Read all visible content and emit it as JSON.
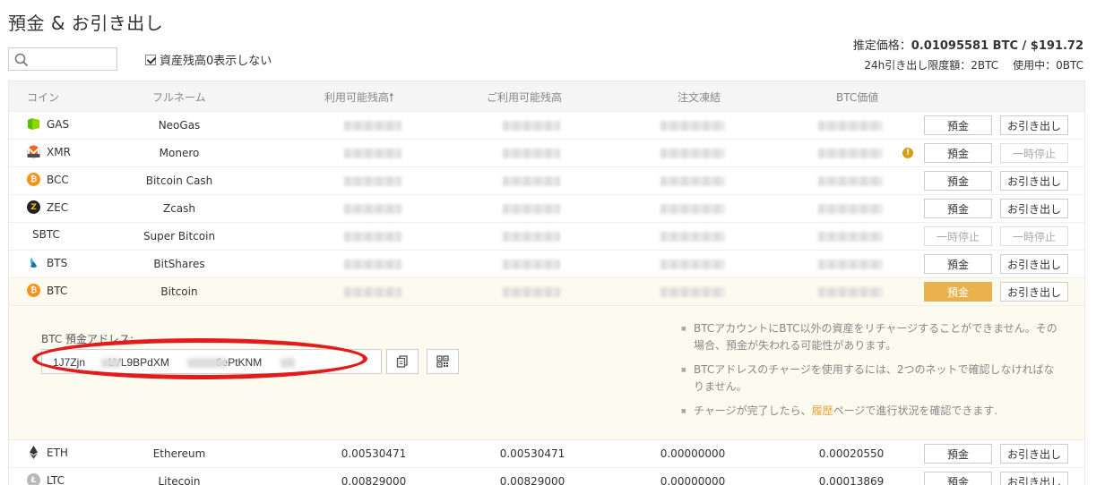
{
  "page": {
    "title": "預金 & お引き出し",
    "search_placeholder": "",
    "hide_zero_label": "資産残高0表示しない",
    "estimate_label": "推定価格：",
    "estimate_value": "0.01095581 BTC / $191.72",
    "limit_label": "24h引き出し限度額：2BTC",
    "in_use_label": "使用中：0BTC"
  },
  "table": {
    "headers": {
      "coin": "コイン",
      "fullname": "フルネーム",
      "available": "利用可能残高",
      "your_available": "ご利用可能残高",
      "frozen": "注文凍結",
      "btc_value": "BTC価値"
    },
    "deposit_label": "預金",
    "withdraw_label": "お引き出し",
    "suspended_label": "一時停止",
    "rows": [
      {
        "coin": "GAS",
        "name": "NeoGas",
        "icon": "neogas-icon",
        "color": "#58bf00"
      },
      {
        "coin": "XMR",
        "name": "Monero",
        "icon": "monero-icon",
        "color": "#f26822"
      },
      {
        "coin": "BCC",
        "name": "Bitcoin Cash",
        "icon": "bitcoin-cash-icon",
        "color": "#f7931a"
      },
      {
        "coin": "ZEC",
        "name": "Zcash",
        "icon": "zcash-icon",
        "color": "#222222"
      },
      {
        "coin": "SBTC",
        "name": "Super Bitcoin",
        "icon": "",
        "color": ""
      },
      {
        "coin": "BTS",
        "name": "BitShares",
        "icon": "bitshares-icon",
        "color": "#35baeb"
      },
      {
        "coin": "BTC",
        "name": "Bitcoin",
        "icon": "bitcoin-icon",
        "color": "#f7931a"
      }
    ],
    "eth_row": {
      "coin": "ETH",
      "name": "Ethereum",
      "available": "0.00530471",
      "your_available": "0.00530471",
      "frozen": "0.00000000",
      "btc_value": "0.00020550"
    },
    "ltc_row": {
      "coin": "LTC",
      "name": "Litecoin",
      "available": "0.00829000",
      "your_available": "0.00829000",
      "frozen": "0.00000000",
      "btc_value": "0.00013869"
    }
  },
  "deposit_detail": {
    "address_label": "BTC 預金アドレス:",
    "address_part1": "1J7Zjn",
    "address_part2": "LVL9BPdXM",
    "address_part3": "6ePtKNM",
    "notes": [
      "BTCアカウントにBTC以外の資産をリチャージすることができません。その場合、預金が失われる可能性があります。",
      "BTCアドレスのチャージを使用するには、2つのネットで確認しなければなりません。"
    ],
    "note3_before": "チャージが完了したら、",
    "note3_link": "履歴",
    "note3_after": "ページで進行状況を確認できます."
  },
  "colors": {
    "accent": "#e9b24c",
    "highlight": "#e31b1b",
    "link": "#e9a63b"
  }
}
